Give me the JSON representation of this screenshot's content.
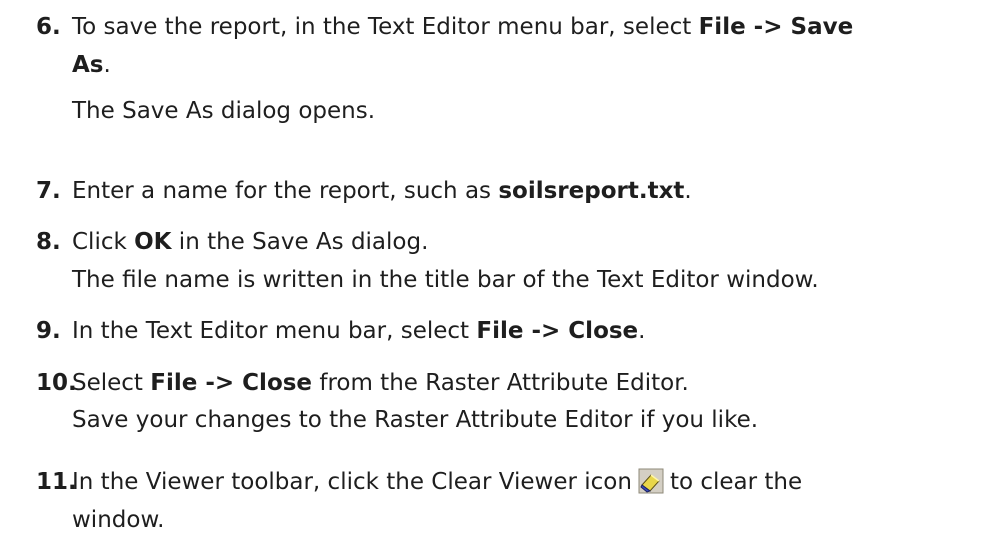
{
  "steps": [
    {
      "number": "6.",
      "text_a": "To save the report, in the Text Editor menu bar, select ",
      "bold_a": "File -> Save",
      "line2_bold": "As",
      "line2_rest": ".",
      "result": "The Save As dialog opens."
    },
    {
      "number": "7.",
      "text_a": "Enter a name for the report, such as ",
      "bold_a": "soilsreport.txt",
      "text_b": "."
    },
    {
      "number": "8.",
      "text_a": "Click ",
      "bold_a": "OK",
      "text_b": " in the Save As dialog.",
      "result": "The file name is written in the title bar of the Text Editor window."
    },
    {
      "number": "9.",
      "text_a": "In the Text Editor menu bar, select ",
      "bold_a": "File -> Close",
      "text_b": "."
    },
    {
      "number": "10.",
      "text_a": "Select ",
      "bold_a": "File -> Close",
      "text_b": " from the Raster Attribute Editor.",
      "result": "Save your changes to the Raster Attribute Editor if you like."
    },
    {
      "number": "11.",
      "text_a": "In the Viewer toolbar, click the Clear Viewer icon",
      "text_b": "to clear the",
      "line2": "window.",
      "icon": "eraser-icon"
    }
  ]
}
